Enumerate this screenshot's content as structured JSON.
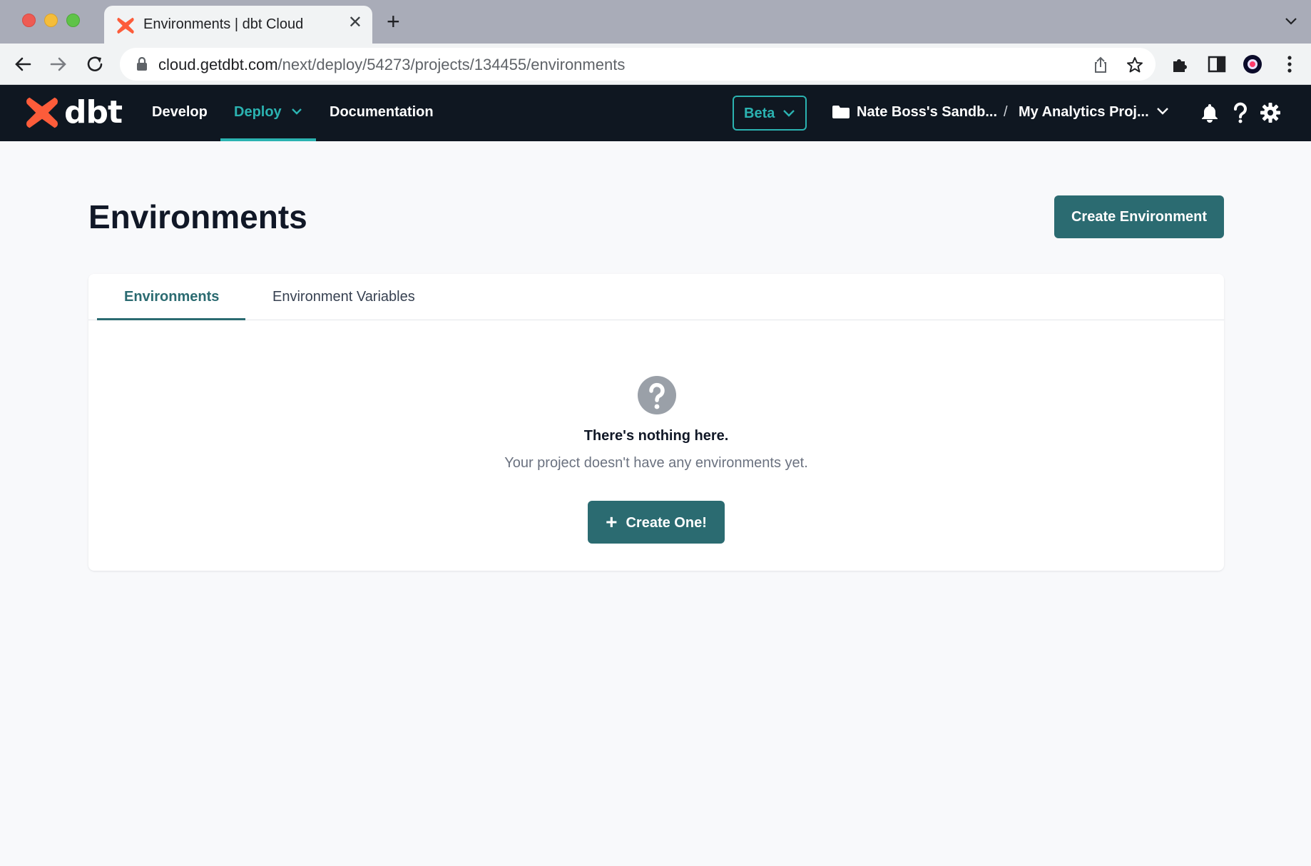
{
  "browser": {
    "tab_title": "Environments | dbt Cloud",
    "url_domain": "cloud.getdbt.com",
    "url_path": "/next/deploy/54273/projects/134455/environments"
  },
  "header": {
    "logo_text": "dbt",
    "nav": {
      "develop": "Develop",
      "deploy": "Deploy",
      "documentation": "Documentation"
    },
    "beta_label": "Beta",
    "account": "Nate Boss's Sandb...",
    "separator": "/",
    "project": "My Analytics Proj..."
  },
  "page": {
    "title": "Environments",
    "create_button": "Create Environment",
    "tabs": [
      {
        "label": "Environments",
        "active": true
      },
      {
        "label": "Environment Variables",
        "active": false
      }
    ],
    "empty_state": {
      "title": "There's nothing here.",
      "description": "Your project doesn't have any environments yet.",
      "button": "Create One!"
    }
  },
  "colors": {
    "accent": "#2bb3b1",
    "primary_button": "#2b6b71",
    "header_bg": "#0f1721",
    "brand": "#fd5c3a"
  },
  "icons": [
    "dbt-logo-icon",
    "lock-icon",
    "share-icon",
    "star-icon",
    "extensions-icon",
    "sidepanel-icon",
    "profile-icon",
    "menu-icon",
    "folder-icon",
    "bell-icon",
    "help-icon",
    "gear-icon",
    "question-circle-icon",
    "plus-icon"
  ]
}
